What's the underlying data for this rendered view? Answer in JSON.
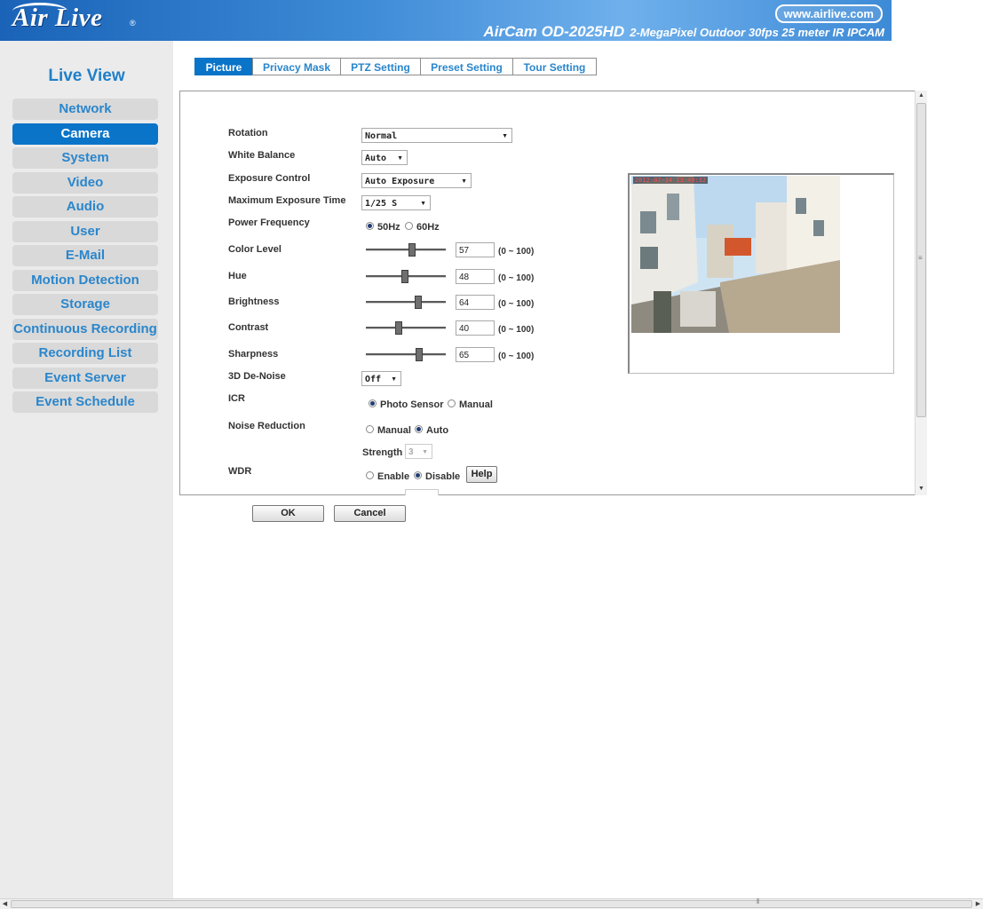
{
  "header": {
    "logo_text": "Air Live",
    "site_url": "www.airlive.com",
    "model": "AirCam OD-2025HD",
    "model_desc": "2-MegaPixel Outdoor 30fps 25 meter IR IPCAM"
  },
  "sidebar": {
    "live_view": "Live View",
    "items": [
      {
        "label": "Network",
        "active": false
      },
      {
        "label": "Camera",
        "active": true
      },
      {
        "label": "System",
        "active": false
      },
      {
        "label": "Video",
        "active": false
      },
      {
        "label": "Audio",
        "active": false
      },
      {
        "label": "User",
        "active": false
      },
      {
        "label": "E-Mail",
        "active": false
      },
      {
        "label": "Motion Detection",
        "active": false
      },
      {
        "label": "Storage",
        "active": false
      },
      {
        "label": "Continuous Recording",
        "active": false
      },
      {
        "label": "Recording List",
        "active": false
      },
      {
        "label": "Event Server",
        "active": false
      },
      {
        "label": "Event Schedule",
        "active": false
      }
    ]
  },
  "tabs": [
    {
      "label": "Picture",
      "active": true
    },
    {
      "label": "Privacy Mask",
      "active": false
    },
    {
      "label": "PTZ Setting",
      "active": false
    },
    {
      "label": "Preset Setting",
      "active": false
    },
    {
      "label": "Tour Setting",
      "active": false
    }
  ],
  "settings": {
    "rotation": {
      "label": "Rotation",
      "value": "Normal"
    },
    "white_balance": {
      "label": "White Balance",
      "value": "Auto"
    },
    "exposure_control": {
      "label": "Exposure Control",
      "value": "Auto Exposure"
    },
    "max_exposure_time": {
      "label": "Maximum Exposure Time",
      "value": "1/25 S"
    },
    "power_frequency": {
      "label": "Power Frequency",
      "option1": "50Hz",
      "option2": "60Hz",
      "selected": "50Hz"
    },
    "sliders": [
      {
        "label": "Color Level",
        "value": "57",
        "range": "(0 ~ 100)"
      },
      {
        "label": "Hue",
        "value": "48",
        "range": "(0 ~ 100)"
      },
      {
        "label": "Brightness",
        "value": "64",
        "range": "(0 ~ 100)"
      },
      {
        "label": "Contrast",
        "value": "40",
        "range": "(0 ~ 100)"
      },
      {
        "label": "Sharpness",
        "value": "65",
        "range": "(0 ~ 100)"
      }
    ],
    "denoise": {
      "label": "3D De-Noise",
      "value": "Off"
    },
    "icr": {
      "label": "ICR",
      "option1": "Photo Sensor",
      "option2": "Manual",
      "selected": "Photo Sensor"
    },
    "noise_reduction": {
      "label": "Noise Reduction",
      "option1": "Manual",
      "option2": "Auto",
      "selected": "Auto",
      "strength_label": "Strength",
      "strength_value": "3"
    },
    "wdr": {
      "label": "WDR",
      "option1": "Enable",
      "option2": "Disable",
      "selected": "Disable",
      "help_label": "Help"
    }
  },
  "preview": {
    "timestamp": "2012-07-14 13:49:32"
  },
  "buttons": {
    "ok": "OK",
    "cancel": "Cancel"
  },
  "colors": {
    "accent": "#0a74c8",
    "nav_text": "#2a86cc",
    "header": "#3d8ad6"
  }
}
